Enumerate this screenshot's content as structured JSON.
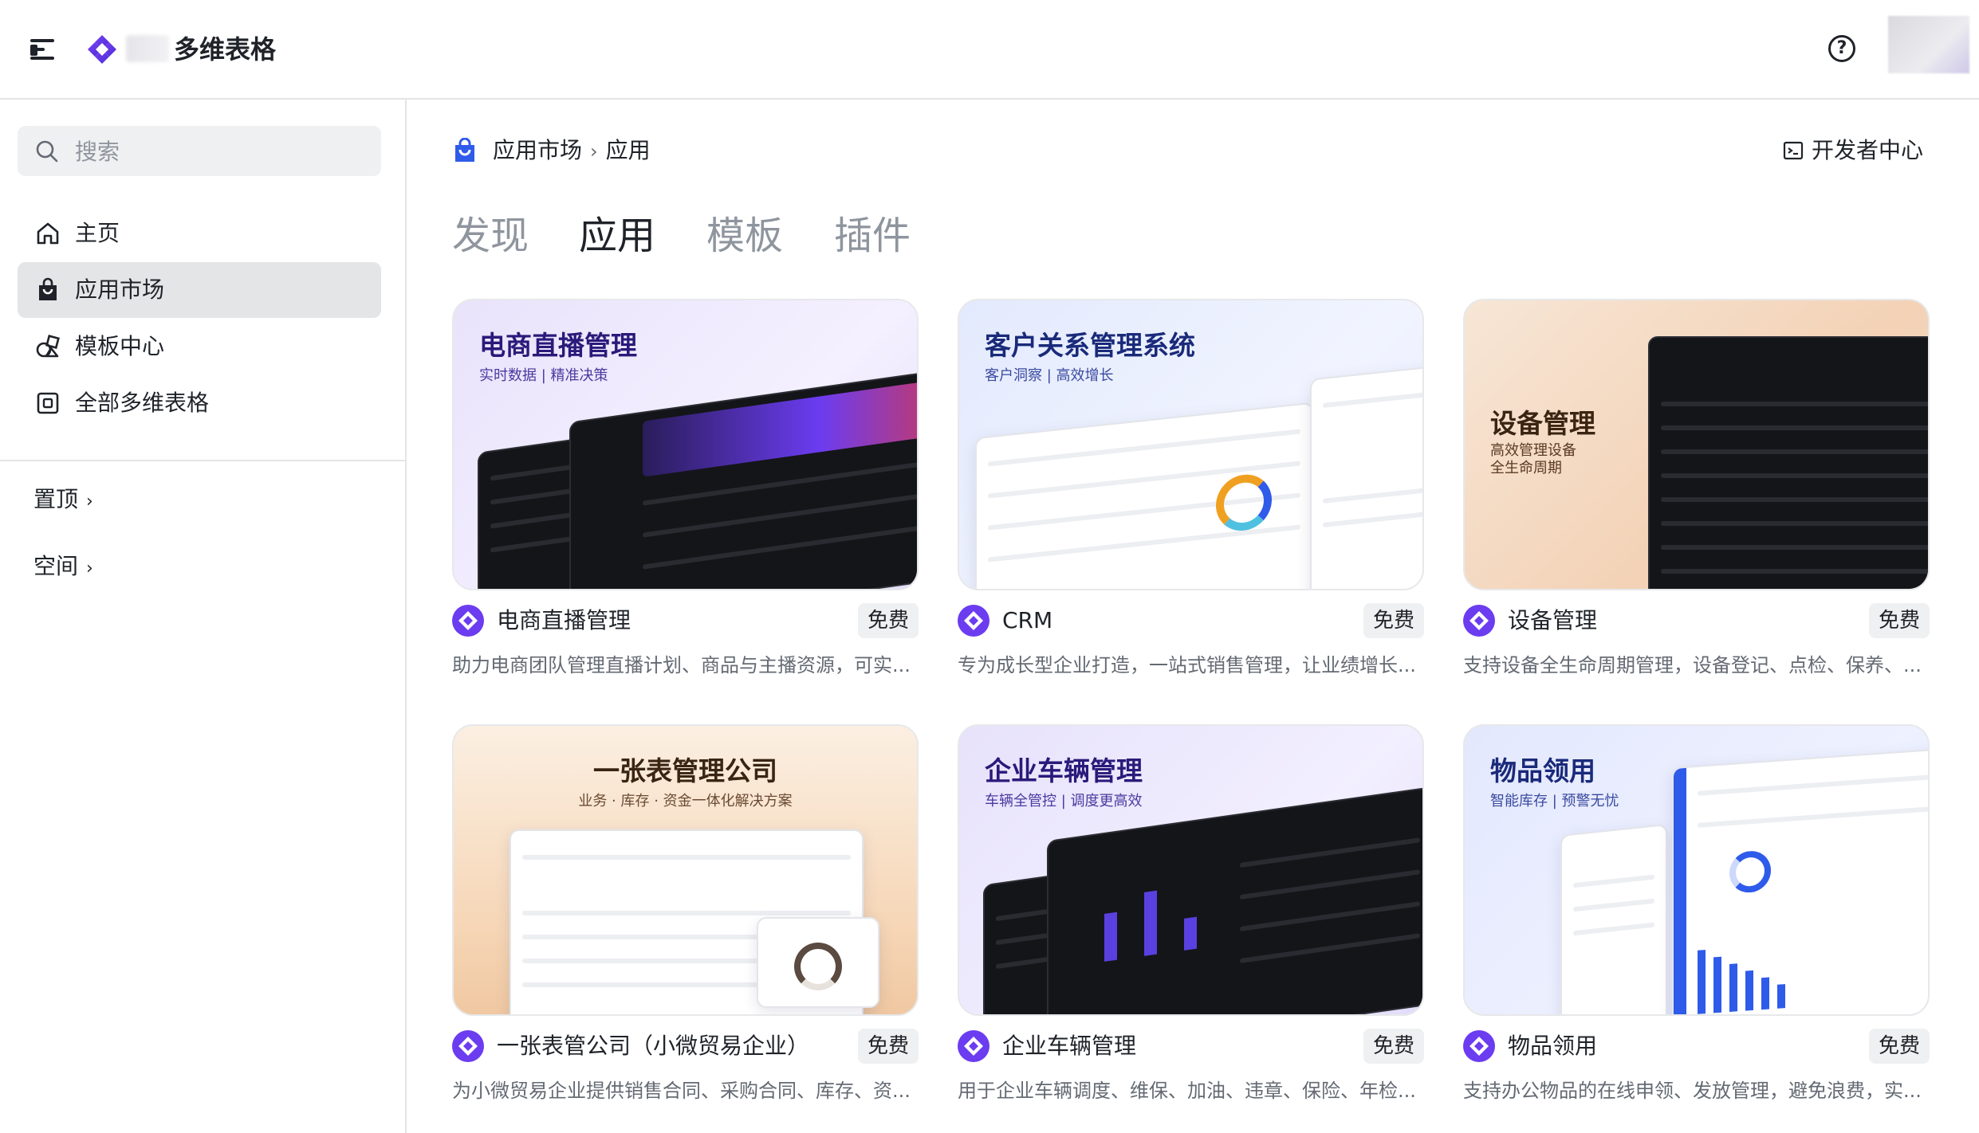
{
  "header": {
    "app_name": "多维表格",
    "help_icon": "question-circle-icon"
  },
  "sidebar": {
    "search_placeholder": "搜索",
    "items": [
      {
        "label": "主页",
        "icon": "home-icon"
      },
      {
        "label": "应用市场",
        "icon": "shopping-bag-icon",
        "active": true
      },
      {
        "label": "模板中心",
        "icon": "template-shapes-icon"
      },
      {
        "label": "全部多维表格",
        "icon": "base-table-icon"
      }
    ],
    "groups": [
      {
        "label": "置顶"
      },
      {
        "label": "空间"
      }
    ]
  },
  "main": {
    "breadcrumb": [
      "应用市场",
      "应用"
    ],
    "developer_center": "开发者中心",
    "tabs": [
      {
        "label": "发现"
      },
      {
        "label": "应用",
        "active": true
      },
      {
        "label": "模板"
      },
      {
        "label": "插件"
      }
    ],
    "cards": [
      {
        "name": "电商直播管理",
        "badge": "免费",
        "description": "助力电商团队管理直播计划、商品与主播资源，可实...",
        "thumb_title": "电商直播管理",
        "thumb_subtitle": "实时数据 | 精准决策",
        "thumb_theme": "#ede8fb"
      },
      {
        "name": "CRM",
        "badge": "免费",
        "description": "专为成长型企业打造，一站式销售管理，让业绩增长...",
        "thumb_title": "客户关系管理系统",
        "thumb_subtitle": "客户洞察 | 高效增长",
        "thumb_theme": "#e4ebfd"
      },
      {
        "name": "设备管理",
        "badge": "免费",
        "description": "支持设备全生命周期管理，设备登记、点检、保养、...",
        "thumb_title": "设备管理",
        "thumb_subtitle": "高效管理设备\n全生命周期",
        "thumb_theme": "#f6dcc6"
      },
      {
        "name": "一张表管公司（小微贸易企业）",
        "badge": "免费",
        "description": "为小微贸易企业提供销售合同、采购合同、库存、资...",
        "thumb_title": "一张表管理公司",
        "thumb_subtitle": "业务 · 库存 · 资金一体化解决方案",
        "thumb_theme": "#f8e0c8"
      },
      {
        "name": "企业车辆管理",
        "badge": "免费",
        "description": "用于企业车辆调度、维保、加油、违章、保险、年检...",
        "thumb_title": "企业车辆管理",
        "thumb_subtitle": "车辆全管控 | 调度更高效",
        "thumb_theme": "#e7e4fb"
      },
      {
        "name": "物品领用",
        "badge": "免费",
        "description": "支持办公物品的在线申领、发放管理，避免浪费，实...",
        "thumb_title": "物品领用",
        "thumb_subtitle": "智能库存 | 预警无忧",
        "thumb_theme": "#e3e8fd"
      }
    ]
  },
  "colors": {
    "brand_purple": "#6b3cf0",
    "accent_blue": "#2f5bea",
    "sidebar_active_bg": "#e4e5e7"
  }
}
